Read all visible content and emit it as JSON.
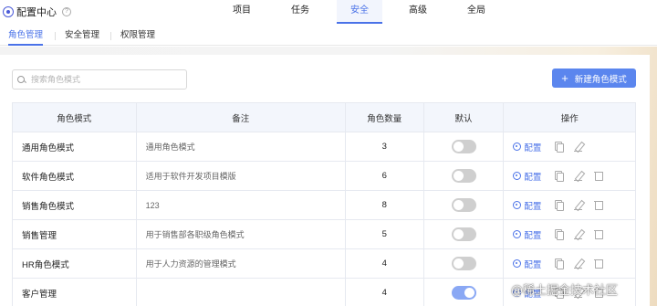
{
  "app": {
    "title": "配置中心",
    "help_glyph": "?"
  },
  "nav": {
    "tabs": [
      {
        "label": "项目"
      },
      {
        "label": "任务"
      },
      {
        "label": "安全",
        "active": true
      },
      {
        "label": "高级"
      },
      {
        "label": "全局"
      }
    ]
  },
  "subtabs": [
    {
      "label": "角色管理",
      "active": true
    },
    {
      "label": "安全管理"
    },
    {
      "label": "权限管理"
    }
  ],
  "search": {
    "placeholder": "搜索角色模式",
    "value": ""
  },
  "toolbar": {
    "new_button_label": "新建角色模式",
    "new_button_icon": "+"
  },
  "table": {
    "headers": [
      "角色模式",
      "备注",
      "角色数量",
      "默认",
      "操作"
    ],
    "rows": [
      {
        "name": "通用角色模式",
        "note": "通用角色模式",
        "count": "3",
        "default": false,
        "deletable": false
      },
      {
        "name": "软件角色模式",
        "note": "适用于软件开发项目模版",
        "count": "6",
        "default": false,
        "deletable": true
      },
      {
        "name": "销售角色模式",
        "note": "123",
        "count": "8",
        "default": false,
        "deletable": true
      },
      {
        "name": "销售管理",
        "note": "用于销售部各职级角色模式",
        "count": "5",
        "default": false,
        "deletable": true
      },
      {
        "name": "HR角色模式",
        "note": "用于人力资源的管理模式",
        "count": "4",
        "default": false,
        "deletable": true
      },
      {
        "name": "客户管理",
        "note": "",
        "count": "4",
        "default": true,
        "deletable": true
      }
    ],
    "config_label": "配置"
  },
  "watermark": "@稀土掘金技术社区",
  "colors": {
    "accent": "#4a72e8",
    "button": "#5b86ee",
    "toggle_on": "#8aa8f4",
    "toggle_off": "#cfcfcf",
    "header_bg": "#f3f6fc"
  }
}
